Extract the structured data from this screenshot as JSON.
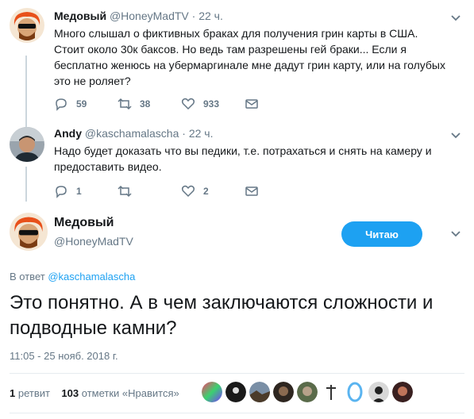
{
  "tweet1": {
    "name": "Медовый",
    "handle": "@HoneyMadTV",
    "dot": "·",
    "time": "22 ч.",
    "text": "Много слышал о фиктивных браках для получения грин карты в США. Стоит около 30к баксов. Но ведь там разрешены гей браки... Если я бесплатно женюсь на убермаргинале мне дадут грин карту, или на голубых это не роляет?",
    "replies": "59",
    "retweets": "38",
    "likes": "933"
  },
  "tweet2": {
    "name": "Andy",
    "handle": "@kaschamalascha",
    "dot": "·",
    "time": "22 ч.",
    "text": "Надо будет доказать что вы педики, т.е. потрахаться и снять на камеру и предоставить видео.",
    "replies": "1",
    "retweets": "",
    "likes": "2"
  },
  "main": {
    "name": "Медовый",
    "handle": "@HoneyMadTV",
    "follow_label": "Читаю",
    "reply_prefix": "В ответ",
    "reply_handle": "@kaschamalascha",
    "text": "Это понятно. А в чем заключаются сложности и подводные камни?",
    "timestamp": "11:05 - 25 нояб. 2018 г.",
    "retweet_count": "1",
    "retweet_label": "ретвит",
    "like_count": "103",
    "like_label": "отметки «Нравится»"
  },
  "colors": {
    "accent": "#1da1f2",
    "secondary_text": "#657786",
    "thread_line": "#ccd6dd"
  },
  "likers": [
    "rainbow-avatar",
    "dark-avatar",
    "landscape-avatar",
    "face-avatar",
    "camo-avatar",
    "cross-avatar",
    "blue-ring-avatar",
    "portrait-avatar",
    "red-avatar"
  ]
}
